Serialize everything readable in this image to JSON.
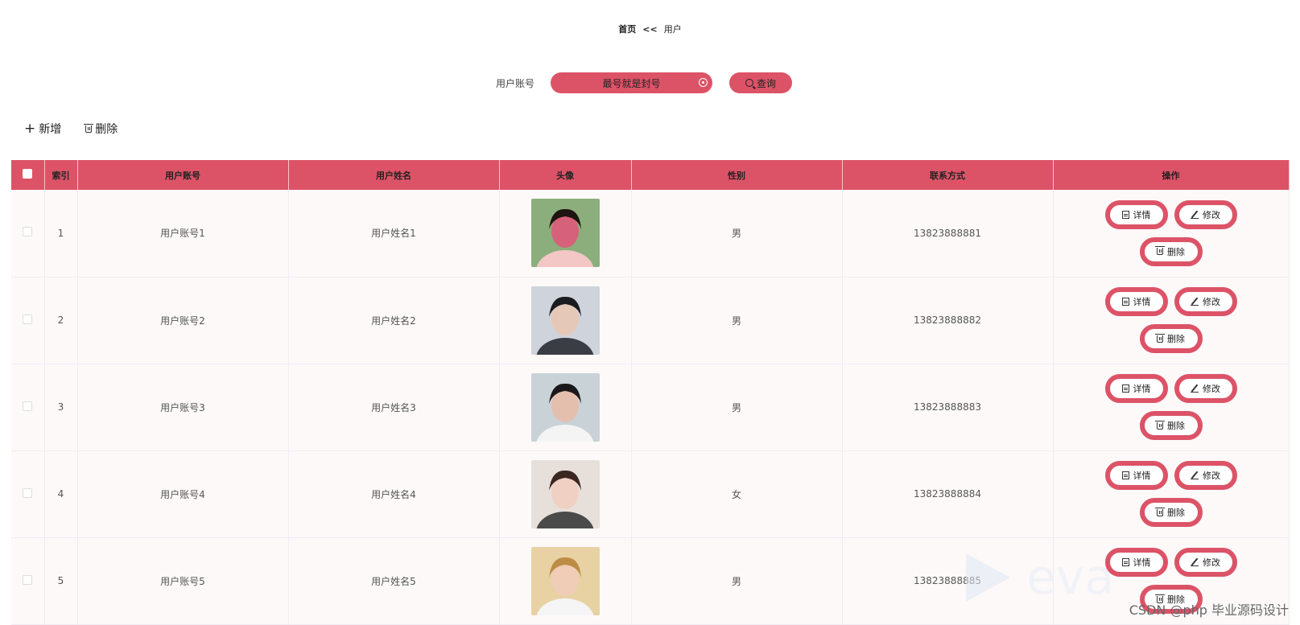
{
  "breadcrumb": {
    "home": "首页",
    "sep": "<<",
    "current": "用户"
  },
  "search": {
    "label": "用户账号",
    "value": "最号就是封号",
    "button": "查询"
  },
  "toolbar": {
    "add": "新增",
    "delete": "删除"
  },
  "table": {
    "headers": [
      "索引",
      "用户账号",
      "用户姓名",
      "头像",
      "性别",
      "联系方式",
      "操作"
    ],
    "rows": [
      {
        "index": "1",
        "account": "用户账号1",
        "name": "用户姓名1",
        "gender": "男",
        "phone": "13823888881"
      },
      {
        "index": "2",
        "account": "用户账号2",
        "name": "用户姓名2",
        "gender": "男",
        "phone": "13823888882"
      },
      {
        "index": "3",
        "account": "用户账号3",
        "name": "用户姓名3",
        "gender": "男",
        "phone": "13823888883"
      },
      {
        "index": "4",
        "account": "用户账号4",
        "name": "用户姓名4",
        "gender": "女",
        "phone": "13823888884"
      },
      {
        "index": "5",
        "account": "用户账号5",
        "name": "用户姓名5",
        "gender": "男",
        "phone": "13823888885"
      }
    ],
    "actions": {
      "detail": "详情",
      "edit": "修改",
      "delete": "删除"
    }
  },
  "watermark": "CSDN @php 毕业源码设计",
  "colors": {
    "accent": "#dc5367",
    "row_bg": "#fdf9f9"
  },
  "icons": [
    "checkbox-icon",
    "plus-icon",
    "trash-icon",
    "search-icon",
    "clear-icon",
    "document-icon",
    "edit-icon"
  ]
}
